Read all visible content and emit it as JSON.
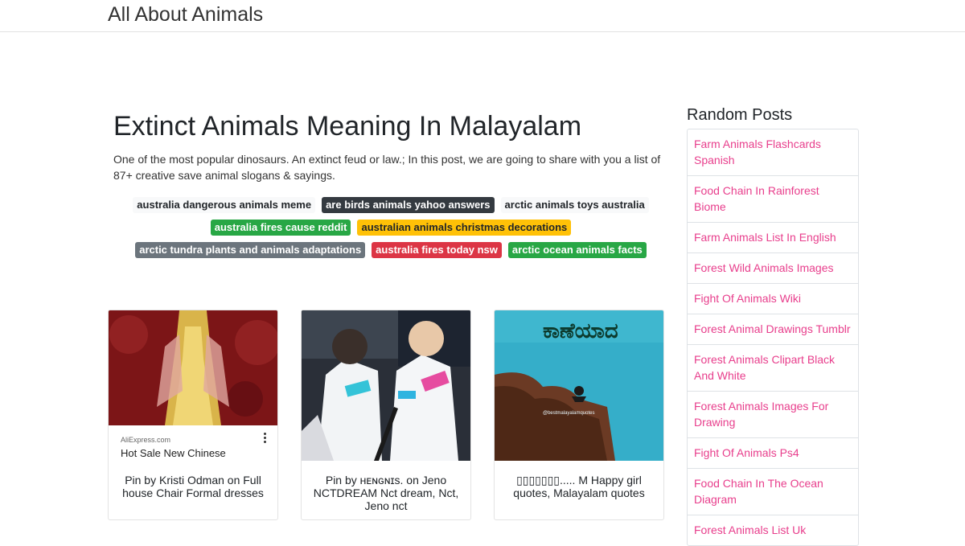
{
  "site": {
    "brand": "All About Animals"
  },
  "post": {
    "title": "Extinct Animals Meaning In Malayalam",
    "excerpt": "One of the most popular dinosaurs. An extinct feud or law.; In this post, we are going to share with you a list of 87+ creative save animal slogans & sayings.",
    "tags": [
      {
        "label": "australia dangerous animals meme",
        "style": "light"
      },
      {
        "label": "are birds animals yahoo answers",
        "style": "dark"
      },
      {
        "label": "arctic animals toys australia",
        "style": "light"
      },
      {
        "label": "australia fires cause reddit",
        "style": "success"
      },
      {
        "label": "australian animals christmas decorations",
        "style": "warning"
      },
      {
        "label": "arctic tundra plants and animals adaptations",
        "style": "secondary"
      },
      {
        "label": "australia fires today nsw",
        "style": "danger"
      },
      {
        "label": "arctic ocean animals facts",
        "style": "success"
      }
    ]
  },
  "cards": [
    {
      "image_source": "AliExpress.com",
      "image_title": "Hot Sale New Chinese",
      "caption": "Pin by Kristi Odman on Full house Chair Formal dresses"
    },
    {
      "caption": "Pin by ʜᴇɴɢɴɪs. on Jeno NCTDREAM Nct dream, Nct, Jeno nct"
    },
    {
      "image_text": "ಕಾಣೆಯಾದ",
      "image_credit": "@bestmalayalamquotes",
      "caption": "▯▯▯▯▯▯▯..... M Happy girl quotes, Malayalam quotes"
    }
  ],
  "sidebar": {
    "title": "Random Posts",
    "items": [
      {
        "label": "Farm Animals Flashcards Spanish"
      },
      {
        "label": "Food Chain In Rainforest Biome"
      },
      {
        "label": "Farm Animals List In English"
      },
      {
        "label": "Forest Wild Animals Images"
      },
      {
        "label": "Fight Of Animals Wiki"
      },
      {
        "label": "Forest Animal Drawings Tumblr"
      },
      {
        "label": "Forest Animals Clipart Black And White"
      },
      {
        "label": "Forest Animals Images For Drawing"
      },
      {
        "label": "Fight Of Animals Ps4"
      },
      {
        "label": "Food Chain In The Ocean Diagram"
      },
      {
        "label": "Forest Animals List Uk"
      }
    ]
  },
  "colors": {
    "link_pink": "#e83e8c",
    "tag_dark": "#343a40",
    "tag_success": "#28a745",
    "tag_warning": "#ffc107",
    "tag_secondary": "#6c757d",
    "tag_danger": "#dc3545"
  }
}
